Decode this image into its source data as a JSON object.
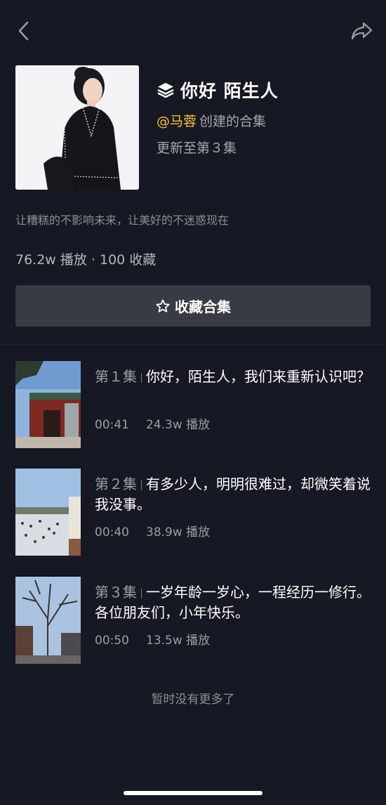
{
  "nav": {
    "back_icon": "chevron-left-icon",
    "share_icon": "share-arrow-icon"
  },
  "header": {
    "title": "你好 陌生人",
    "title_icon": "layers-icon",
    "creator_name": "@马蓉",
    "creator_suffix": "创建的合集",
    "update_text": "更新至第３集"
  },
  "description": "让糟糕的不影响未来，让美好的不迷惑现在",
  "stats": "76.2w 播放 · 100 收藏",
  "favorite_button": {
    "label": "收藏合集",
    "icon": "star-outline-icon"
  },
  "episodes": [
    {
      "number": "第１集",
      "title": "你好，陌生人，我们来重新认识吧？",
      "duration": "00:41",
      "plays": "24.3w 播放"
    },
    {
      "number": "第２集",
      "title": "有多少人，明明很难过，却微笑着说我没事。",
      "duration": "00:40",
      "plays": "38.9w 播放"
    },
    {
      "number": "第３集",
      "title": "一岁年龄一岁心，一程经历一修行。各位朋友们，小年快乐。",
      "duration": "00:50",
      "plays": "13.5w 播放"
    }
  ],
  "footer": {
    "no_more": "暂时没有更多了"
  },
  "colors": {
    "background": "#161823",
    "accent": "#f8c42b",
    "button": "#393b44"
  }
}
